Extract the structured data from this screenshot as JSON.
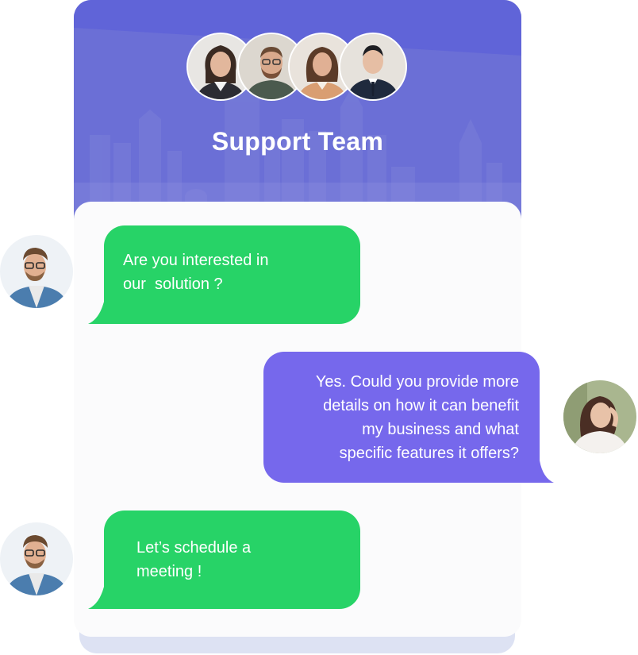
{
  "header": {
    "title": "Support Team",
    "background_color": "#6b6fd6",
    "team_avatars": [
      {
        "icon": "woman-dark-hair-avatar-icon"
      },
      {
        "icon": "man-beard-glasses-avatar-icon"
      },
      {
        "icon": "woman-long-hair-avatar-icon"
      },
      {
        "icon": "man-suit-avatar-icon"
      }
    ]
  },
  "messages": [
    {
      "sender": "agent",
      "lines": [
        "Are you interested in",
        "our  solution ?"
      ],
      "color": "#27d367",
      "avatar_icon": "man-glasses-avatar-icon"
    },
    {
      "sender": "customer",
      "lines": [
        "Yes. Could you provide more",
        "details on how it can benefit",
        "my business and what",
        "specific features it offers?"
      ],
      "color": "#7668ec",
      "avatar_icon": "woman-avatar-icon"
    },
    {
      "sender": "agent",
      "lines": [
        "Let’s schedule a",
        "meeting !"
      ],
      "color": "#27d367",
      "avatar_icon": "man-glasses-avatar-icon"
    }
  ]
}
